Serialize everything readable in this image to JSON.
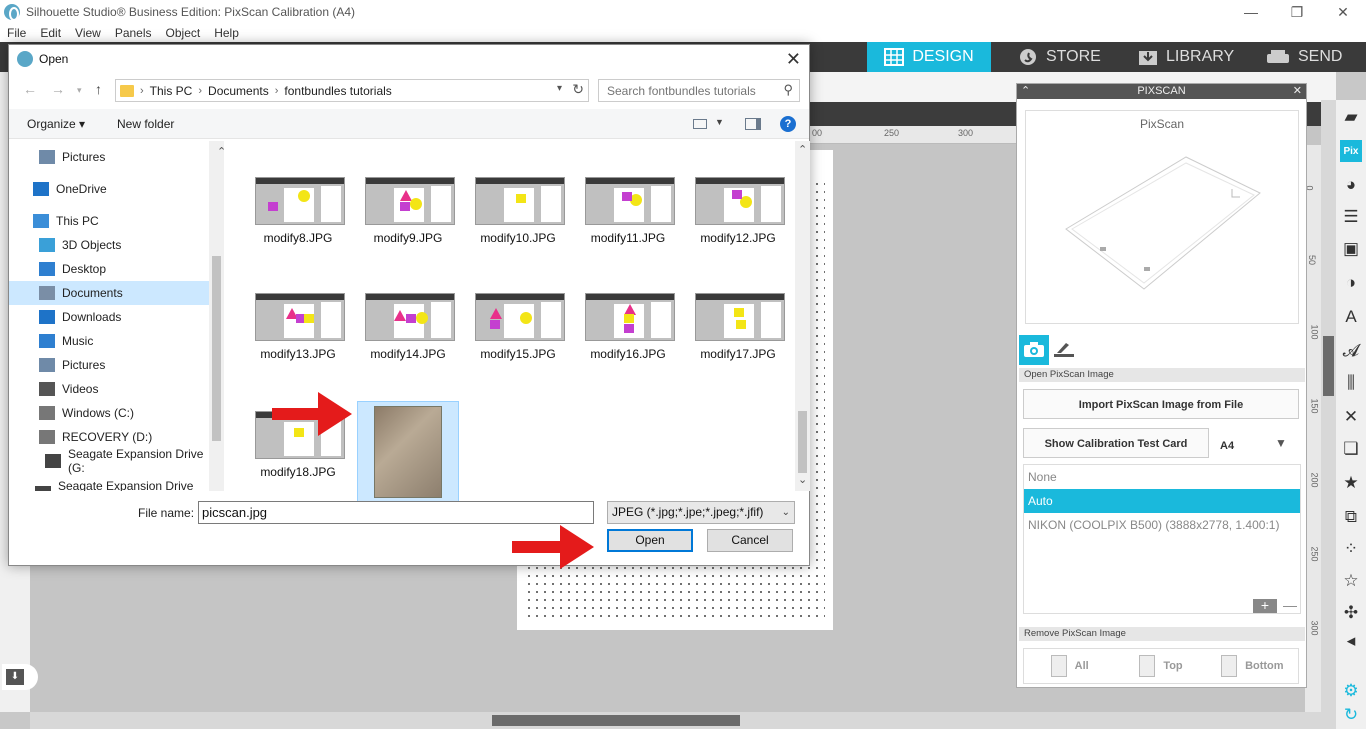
{
  "app": {
    "title": "Silhouette Studio® Business Edition: PixScan Calibration (A4)",
    "window_buttons": [
      "—",
      "❐",
      "✕"
    ],
    "menu": [
      "File",
      "Edit",
      "View",
      "Panels",
      "Object",
      "Help"
    ],
    "nav_tabs": [
      {
        "label": "DESIGN",
        "icon": "grid-icon",
        "active": true
      },
      {
        "label": "STORE",
        "icon": "store-icon",
        "active": false
      },
      {
        "label": "LIBRARY",
        "icon": "library-icon",
        "active": false
      },
      {
        "label": "SEND",
        "icon": "send-icon",
        "active": false
      }
    ],
    "accent_color": "#1ab9dc",
    "ruler_top": [
      "00",
      "250",
      "300"
    ],
    "ruler_right": [
      "0",
      "50",
      "100",
      "150",
      "200",
      "250",
      "300"
    ]
  },
  "pixscan": {
    "header": "PIXSCAN",
    "preview_label": "PixScan",
    "section_open": "Open PixScan Image",
    "import_button": "Import PixScan Image from File",
    "calibration_button": "Show Calibration Test Card",
    "paper_size": "A4",
    "camera_list": [
      {
        "label": "None",
        "selected": false
      },
      {
        "label": "Auto",
        "selected": true
      },
      {
        "label": "NIKON (COOLPIX B500) (3888x2778, 1.400:1)",
        "selected": false
      }
    ],
    "section_remove": "Remove PixScan Image",
    "remove_buttons": [
      "All",
      "Top",
      "Bottom"
    ]
  },
  "dialog": {
    "title": "Open",
    "breadcrumb": [
      "This PC",
      "Documents",
      "fontbundles tutorials"
    ],
    "search_placeholder": "Search fontbundles tutorials",
    "organize": "Organize ▾",
    "new_folder": "New folder",
    "help": "?",
    "nav_items": [
      {
        "label": "Pictures",
        "icon": "pictures-folder-icon",
        "selected": false
      },
      {
        "label": "OneDrive",
        "icon": "onedrive-icon",
        "selected": false
      },
      {
        "label": "This PC",
        "icon": "computer-icon",
        "selected": false
      },
      {
        "label": "3D Objects",
        "icon": "3d-objects-icon",
        "selected": false
      },
      {
        "label": "Desktop",
        "icon": "desktop-icon",
        "selected": false
      },
      {
        "label": "Documents",
        "icon": "documents-icon",
        "selected": true
      },
      {
        "label": "Downloads",
        "icon": "downloads-icon",
        "selected": false
      },
      {
        "label": "Music",
        "icon": "music-icon",
        "selected": false
      },
      {
        "label": "Pictures",
        "icon": "pictures-folder-icon",
        "selected": false
      },
      {
        "label": "Videos",
        "icon": "videos-icon",
        "selected": false
      },
      {
        "label": "Windows (C:)",
        "icon": "drive-icon",
        "selected": false
      },
      {
        "label": "RECOVERY (D:)",
        "icon": "drive-icon",
        "selected": false
      },
      {
        "label": "Seagate Expansion Drive (G:",
        "icon": "external-drive-icon",
        "selected": false
      },
      {
        "label": "Seagate Expansion Drive (G:)",
        "icon": "external-drive-icon",
        "selected": false
      }
    ],
    "files": [
      {
        "name": "modify8.JPG"
      },
      {
        "name": "modify9.JPG"
      },
      {
        "name": "modify10.JPG"
      },
      {
        "name": "modify11.JPG"
      },
      {
        "name": "modify12.JPG"
      },
      {
        "name": "modify13.JPG"
      },
      {
        "name": "modify14.JPG"
      },
      {
        "name": "modify15.JPG"
      },
      {
        "name": "modify16.JPG"
      },
      {
        "name": "modify17.JPG"
      },
      {
        "name": "modify18.JPG"
      },
      {
        "name": "picscan.jpg",
        "selected": true
      }
    ],
    "file_name_label": "File name:",
    "file_name_value": "picscan.jpg",
    "file_type": "JPEG (*.jpg;*.jpe;*.jpeg;*.jfif)",
    "open_button": "Open",
    "cancel_button": "Cancel"
  }
}
